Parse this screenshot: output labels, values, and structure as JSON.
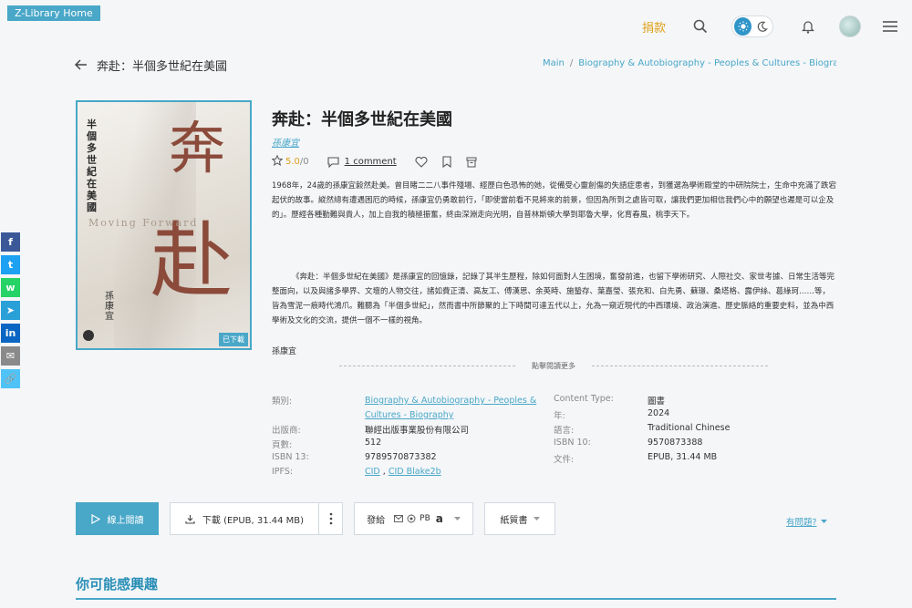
{
  "app": {
    "home_label": "Z-Library Home"
  },
  "topbar": {
    "donate_label": "捐款"
  },
  "header": {
    "back_title": "奔赴：半個多世紀在美國"
  },
  "breadcrumb": {
    "main": "Main",
    "sep": "/",
    "category": "Biography & Autobiography - Peoples & Cultures - Biogra"
  },
  "cover": {
    "vertical_title": "半個多世紀在美國",
    "big_char_1": "奔",
    "big_char_2": "赴",
    "english_title": "Moving Forward",
    "author_vertical": "孫康宜",
    "badge": "已下載"
  },
  "book": {
    "title": "奔赴：半個多世紀在美國",
    "author": "孫康宜",
    "rating_score": "5.0",
    "rating_sep": " / ",
    "rating_count": "0",
    "comments": "1 comment",
    "description_1": "1968年，24歲的孫康宜毅然赴美。曾目睹二二八事件殘場、經歷白色恐怖的她，從備受心靈創傷的失語症患者，到獲選為學術殿堂的中研院院士，生命中充滿了跌宕起伏的故事。縱然總有遭遇困厄的時候，孫康宜仍勇敢前行，「即使當前看不見將來的前景，但因為所到之處皆可取，讓我們更加相信我們心中的願望也遲是可以企及的」。歷經各種勤難與貴人，加上自我的積極振奮，終由深淵走向光明，自普林斯頓大學到耶魯大學，化育春風，桃李天下。",
    "description_2": "《奔赴：半個多世紀在美國》是孫康宜的回憶錄，記錄了其半生歷程，除如何面對人生困境，奮發前進，也留下學術研究、人際社交、家世考據、日常生活等完整面向，以及與諸多學界、文壇的人物交往，諸如費正清、高友工、傅漢思、余英時、施蟄存、葉嘉瑩、張充和、白先勇、蘇璟、桑塔格、露伊絲、葛綠珂……等，皆為雪泥一痕時代鴻爪。難聽為「半個多世紀」，然而書中所節聚的上下時間可達五代以上，允為一窺近現代的中西環境、政治演進、歷史脈絡的重要史料，並為中西學術及文化的交流，提供一個不一樣的視角。",
    "description_author": "孫康宜",
    "read_more": "點擊閱讀更多"
  },
  "properties": {
    "category_label": "類別:",
    "category_value": "Biography & Autobiography - Peoples & Cultures - Biography",
    "content_type_label": "Content Type:",
    "content_type_value": "圖書",
    "year_label": "年:",
    "year_value": "2024",
    "publisher_label": "出版商:",
    "publisher_value": "聯經出版事業股份有限公司",
    "language_label": "語言:",
    "language_value": "Traditional Chinese",
    "pages_label": "頁數:",
    "pages_value": "512",
    "isbn10_label": "ISBN 10:",
    "isbn10_value": "9570873388",
    "isbn13_label": "ISBN 13:",
    "isbn13_value": "9789570873382",
    "file_label": "文件:",
    "file_value": "EPUB, 31.44 MB",
    "ipfs_label": "IPFS:",
    "ipfs_cid": "CID",
    "ipfs_sep": " , ",
    "ipfs_blake": "CID Blake2b"
  },
  "actions": {
    "read_online": "線上閱讀",
    "download": "下載 (EPUB, 31.44 MB)",
    "send_to": "發給",
    "send_pb": "PB",
    "paper_book": "紙質書",
    "problem": "有問題?"
  },
  "suggest": {
    "title": "你可能感興趣"
  },
  "social": [
    {
      "icon": "facebook-icon",
      "color": "#3b5998",
      "glyph": "f"
    },
    {
      "icon": "twitter-icon",
      "color": "#1da1f2",
      "glyph": "t"
    },
    {
      "icon": "whatsapp-icon",
      "color": "#25d366",
      "glyph": "w"
    },
    {
      "icon": "telegram-icon",
      "color": "#2aa0d8",
      "glyph": "➤"
    },
    {
      "icon": "linkedin-icon",
      "color": "#0a66c2",
      "glyph": "in"
    },
    {
      "icon": "email-icon",
      "color": "#8a8a8a",
      "glyph": "✉"
    },
    {
      "icon": "link-icon",
      "color": "#4fc3f7",
      "glyph": "🔗"
    }
  ],
  "colors": {
    "accent": "#49a7c8",
    "donate": "#e0a11b",
    "background": "#f4f6f8"
  }
}
